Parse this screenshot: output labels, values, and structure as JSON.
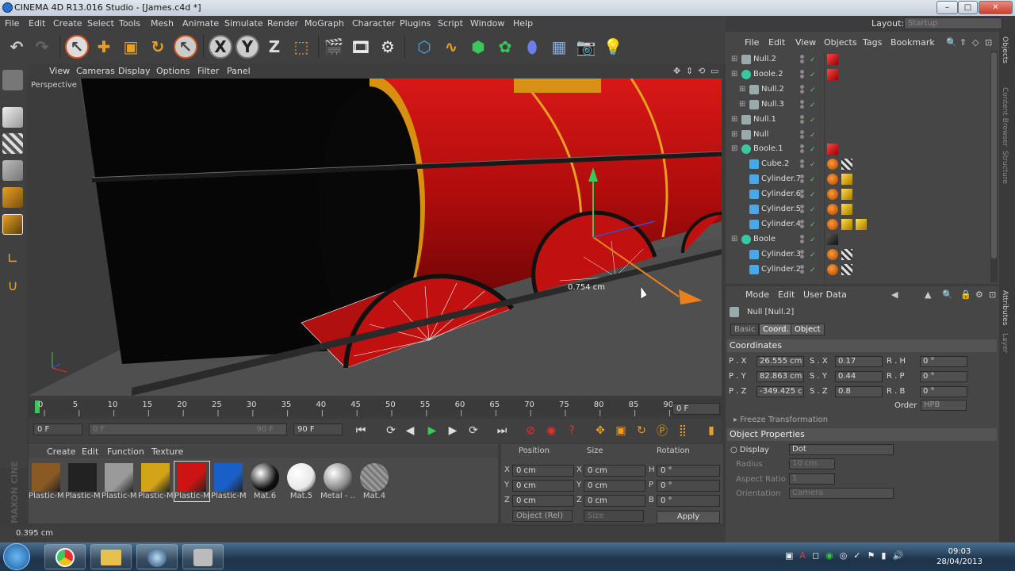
{
  "window": {
    "title": "CINEMA 4D R13.016 Studio - [James.c4d *]",
    "controls": [
      "–",
      "□",
      "✕"
    ]
  },
  "menu": [
    "File",
    "Edit",
    "Create",
    "Select",
    "Tools",
    "Mesh",
    "Animate",
    "Simulate",
    "Render",
    "MoGraph",
    "Character",
    "Plugins",
    "Script",
    "Window",
    "Help"
  ],
  "layout": {
    "label": "Layout:",
    "value": "Startup"
  },
  "viewport": {
    "menu": [
      "View",
      "Cameras",
      "Display",
      "Options",
      "Filter",
      "Panel"
    ],
    "label": "Perspective",
    "measure": "0.754 cm"
  },
  "timeline": {
    "ticks": [
      "0",
      "5",
      "10",
      "15",
      "20",
      "25",
      "30",
      "35",
      "40",
      "45",
      "50",
      "55",
      "60",
      "65",
      "70",
      "75",
      "80",
      "85",
      "90"
    ],
    "current_frame": "0 F"
  },
  "transport": {
    "start": "0 F",
    "range_start": "0 F",
    "range_end": "90 F",
    "end": "90 F"
  },
  "materials": {
    "menu": [
      "Create",
      "Edit",
      "Function",
      "Texture"
    ],
    "items": [
      {
        "label": "Plastic-M",
        "color": "#8a5a24"
      },
      {
        "label": "Plastic-M",
        "color": "#222222"
      },
      {
        "label": "Plastic-M",
        "color": "#9a9a9a"
      },
      {
        "label": "Plastic-M",
        "color": "#d4a418"
      },
      {
        "label": "Plastic-M",
        "color": "#cc1414"
      },
      {
        "label": "Plastic-M",
        "color": "#1a5fc8"
      },
      {
        "label": "Mat.6",
        "color": "#111111"
      },
      {
        "label": "Mat.5",
        "color": "#e8e8e8"
      },
      {
        "label": "Metal - ...",
        "color": "#888888"
      },
      {
        "label": "Mat.4",
        "color": "#666666"
      }
    ]
  },
  "coords": {
    "headers": {
      "position": "Position",
      "size": "Size",
      "rotation": "Rotation"
    },
    "rows": [
      {
        "a": "X",
        "pos": "0 cm",
        "b": "X",
        "size": "0 cm",
        "c": "H",
        "rot": "0 °"
      },
      {
        "a": "Y",
        "pos": "0 cm",
        "b": "Y",
        "size": "0 cm",
        "c": "P",
        "rot": "0 °"
      },
      {
        "a": "Z",
        "pos": "0 cm",
        "b": "Z",
        "size": "0 cm",
        "c": "B",
        "rot": "0 °"
      }
    ],
    "mode": "Object (Rel)",
    "size_mode": "Size",
    "apply": "Apply"
  },
  "status": "0.395 cm",
  "objects": {
    "menu": [
      "File",
      "Edit",
      "View",
      "Objects",
      "Tags",
      "Bookmark"
    ],
    "rows": [
      {
        "name": "Null.2",
        "indent": 0,
        "icon": "null",
        "tags": [
          "red"
        ]
      },
      {
        "name": "Boole.2",
        "indent": 0,
        "icon": "boole",
        "tags": [
          "red"
        ]
      },
      {
        "name": "Null.2",
        "indent": 1,
        "icon": "null",
        "tags": []
      },
      {
        "name": "Null.3",
        "indent": 1,
        "icon": "null",
        "tags": []
      },
      {
        "name": "Null.1",
        "indent": 0,
        "icon": "null",
        "tags": []
      },
      {
        "name": "Null",
        "indent": 0,
        "icon": "null",
        "tags": []
      },
      {
        "name": "Boole.1",
        "indent": 0,
        "icon": "boole",
        "tags": [
          "red"
        ]
      },
      {
        "name": "Cube.2",
        "indent": 1,
        "icon": "cube",
        "tags": [
          "phong",
          "check"
        ]
      },
      {
        "name": "Cylinder.7",
        "indent": 1,
        "icon": "cyl",
        "tags": [
          "phong",
          "yellow"
        ]
      },
      {
        "name": "Cylinder.6",
        "indent": 1,
        "icon": "cyl",
        "tags": [
          "phong",
          "yellow"
        ]
      },
      {
        "name": "Cylinder.5",
        "indent": 1,
        "icon": "cyl",
        "tags": [
          "phong",
          "yellow"
        ]
      },
      {
        "name": "Cylinder.4",
        "indent": 1,
        "icon": "cyl",
        "tags": [
          "phong",
          "yellow",
          "yellow"
        ]
      },
      {
        "name": "Boole",
        "indent": 0,
        "icon": "boole",
        "tags": [
          "black"
        ]
      },
      {
        "name": "Cylinder.3",
        "indent": 1,
        "icon": "cyl",
        "tags": [
          "phong",
          "check"
        ]
      },
      {
        "name": "Cylinder.2",
        "indent": 1,
        "icon": "cyl",
        "tags": [
          "phong",
          "check"
        ]
      }
    ]
  },
  "attributes": {
    "menu": [
      "Mode",
      "Edit",
      "User Data"
    ],
    "object_title": "Null [Null.2]",
    "tabs": [
      "Basic",
      "Coord.",
      "Object"
    ],
    "coord_header": "Coordinates",
    "coord_rows": [
      {
        "pl": "P . X",
        "pv": "26.555 cm",
        "sl": "S . X",
        "sv": "0.17",
        "rl": "R . H",
        "rv": "0 °"
      },
      {
        "pl": "P . Y",
        "pv": "82.863 cm",
        "sl": "S . Y",
        "sv": "0.44",
        "rl": "R . P",
        "rv": "0 °"
      },
      {
        "pl": "P . Z",
        "pv": "-349.425 c",
        "sl": "S . Z",
        "sv": "0.8",
        "rl": "R . B",
        "rv": "0 °"
      }
    ],
    "order_label": "Order",
    "order_value": "HPB",
    "freeze": "Freeze Transformation",
    "objprops_header": "Object Properties",
    "display_label": "Display",
    "display_value": "Dot",
    "radius_label": "Radius",
    "radius_value": "10 cm",
    "aspect_label": "Aspect Ratio",
    "aspect_value": "1",
    "orientation_label": "Orientation",
    "orientation_value": "Camera"
  },
  "side_tabs": [
    "Objects",
    "Content Browser",
    "Structure",
    "Attributes",
    "Layer"
  ],
  "taskbar": {
    "time": "09:03",
    "date": "28/04/2013"
  }
}
